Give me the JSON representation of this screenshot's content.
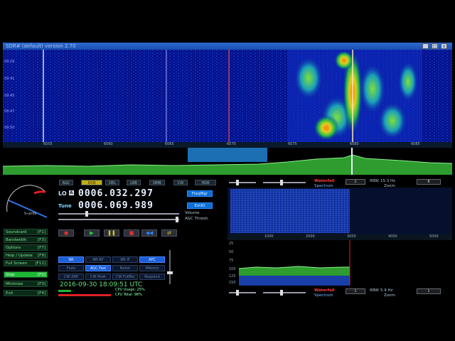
{
  "window": {
    "title": "SDR# (default) version 2.70"
  },
  "waterfall": {
    "times": [
      "09:29",
      "09:41",
      "09:45",
      "09:47",
      "09:50"
    ],
    "freq_ticks": [
      "6055",
      "6060",
      "6065",
      "6070",
      "6075",
      "6080",
      "6085"
    ]
  },
  "agc_buttons": [
    "AGC",
    "DCB",
    "DEL",
    "LBB",
    "DMB",
    "CW",
    "HDR"
  ],
  "tuning": {
    "lo_label": "LO",
    "lo_freq": "0006.032.297",
    "tune_label": "Tune",
    "tune_freq": "0006.069.989",
    "freqmgr_label": "FreqMgr",
    "extio_label": "ExtIO",
    "volume_label": "Volume",
    "agc_thresh_label": "AGC Thresh."
  },
  "sidebar": {
    "items": [
      {
        "label": "Soundcard",
        "key": "[F1]"
      },
      {
        "label": "Bandwidth",
        "key": "[F3]"
      },
      {
        "label": "Options",
        "key": "[F7]"
      },
      {
        "label": "Help / Update",
        "key": "[F9]"
      },
      {
        "label": "Full Screen",
        "key": "[F11]"
      },
      {
        "label": "Stop",
        "key": "[F2]"
      },
      {
        "label": "Minimize",
        "key": "[F3]"
      },
      {
        "label": "Exit",
        "key": "[F4]"
      }
    ]
  },
  "transport": {
    "record_icon": "record-icon",
    "play_icon": "play-icon",
    "pause_icon": "pause-icon",
    "stop_icon": "stop-icon",
    "rewind_icon": "rewind-icon",
    "loop_icon": "loop-icon"
  },
  "dsp_buttons": [
    [
      "NR",
      "NR RF",
      "NR IF",
      "AFC"
    ],
    [
      "Flute",
      "AGC Fast",
      "Notch",
      "MNotch"
    ],
    [
      "CW ZAP",
      "CW Peak",
      "CW FullBw",
      "Respond"
    ]
  ],
  "status": {
    "datetime": "2016-09-30  18:09:51 UTC",
    "cpu_load": "CPU Usage: 25%",
    "cpu_total": "CPU Total: 98%"
  },
  "zoom_top": {
    "waterfall_label": "Waterfall",
    "spectrum_label": "Spectrum",
    "rbw_label": "RBW",
    "rbw_value": "15.3 Hz",
    "zoom_label": "Zoom",
    "ticks": [
      "1000",
      "2000",
      "3000",
      "4000",
      "5000"
    ]
  },
  "zoom_bottom": {
    "waterfall_label": "Waterfall",
    "spectrum_label": "Spectrum",
    "rbw_label": "RBW",
    "rbw_value": "5.9 Hz",
    "zoom_label": "Zoom",
    "db_ticks": [
      "25",
      "50",
      "75",
      "100",
      "125",
      "150"
    ]
  },
  "colors": {
    "waterfall_bg": "#050e7a",
    "spectrum_green": "#2e9c2e",
    "accent_blue": "#0b6fd6",
    "stop_green": "#1db835",
    "datetime_green": "#64e07c"
  }
}
